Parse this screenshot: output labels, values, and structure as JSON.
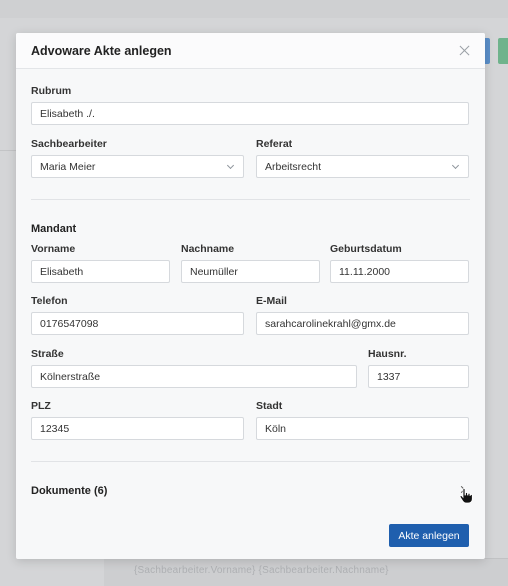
{
  "modal": {
    "title": "Advoware Akte anlegen",
    "close_icon": "close-icon"
  },
  "form": {
    "rubrum": {
      "label": "Rubrum",
      "value": "Elisabeth ./."
    },
    "sachbearbeiter": {
      "label": "Sachbearbeiter",
      "value": "Maria Meier"
    },
    "referat": {
      "label": "Referat",
      "value": "Arbeitsrecht"
    }
  },
  "mandant": {
    "section_title": "Mandant",
    "vorname": {
      "label": "Vorname",
      "value": "Elisabeth"
    },
    "nachname": {
      "label": "Nachname",
      "value": "Neumüller"
    },
    "geburtsdatum": {
      "label": "Geburtsdatum",
      "value": "11.11.2000"
    },
    "telefon": {
      "label": "Telefon",
      "value": "0176547098"
    },
    "email": {
      "label": "E-Mail",
      "value": "sarahcarolinekrahl@gmx.de"
    },
    "strasse": {
      "label": "Straße",
      "value": "Kölnerstraße"
    },
    "hausnr": {
      "label": "Hausnr.",
      "value": "1337"
    },
    "plz": {
      "label": "PLZ",
      "value": "12345"
    },
    "stadt": {
      "label": "Stadt",
      "value": "Köln"
    }
  },
  "dokumente": {
    "section_title": "Dokumente (6)"
  },
  "footer": {
    "submit_label": "Akte anlegen"
  },
  "colors": {
    "primary": "#1f5fae",
    "overlay": "#d9dadc"
  },
  "background_page": {
    "bottom_text": "{Sachbearbeiter.Vorname} {Sachbearbeiter.Nachname}"
  }
}
